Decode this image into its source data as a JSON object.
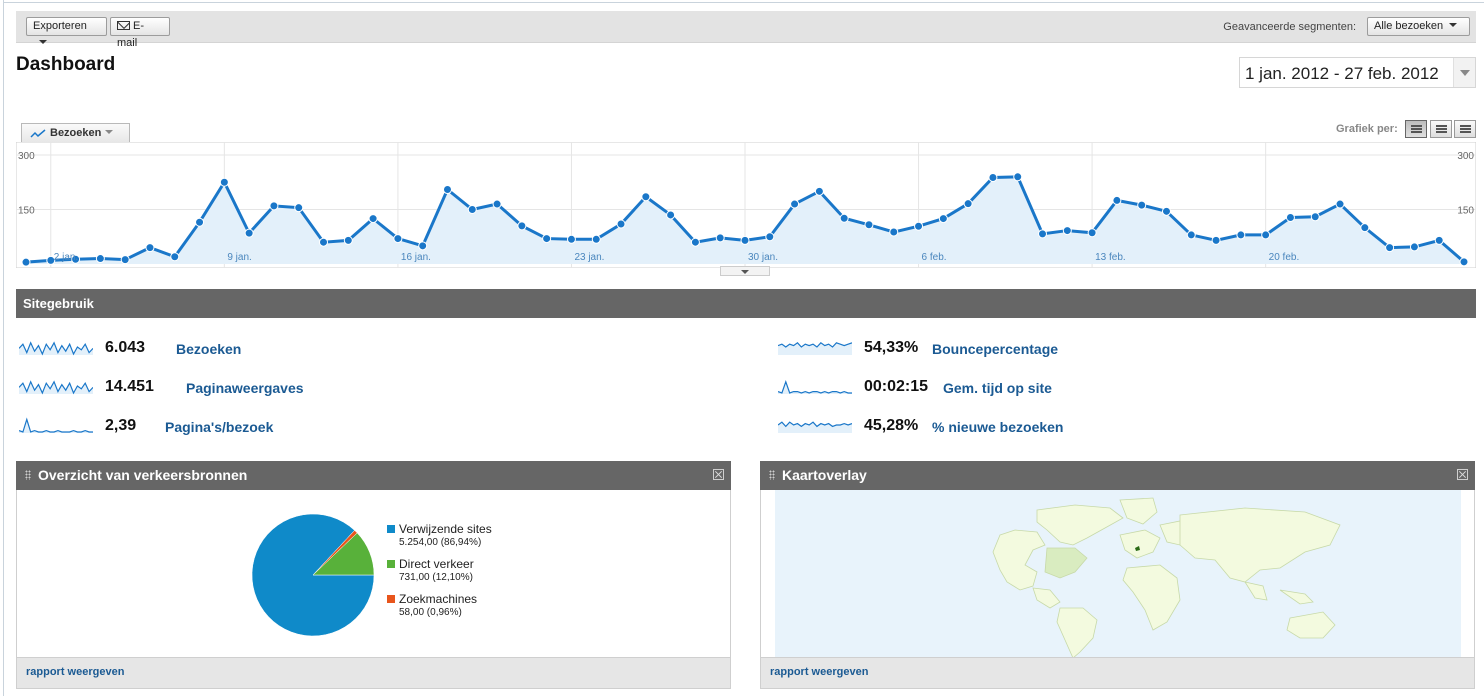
{
  "toolbar": {
    "export_label": "Exporteren",
    "email_label": "E-mail",
    "segments_label": "Geavanceerde segmenten:",
    "segments_value": "Alle bezoeken"
  },
  "page": {
    "title": "Dashboard",
    "date_range": "1 jan. 2012 - 27 feb. 2012"
  },
  "chart_controls": {
    "metric_tab": "Bezoeken",
    "graph_per_label": "Grafiek per:"
  },
  "chart_data": {
    "type": "area",
    "series": [
      {
        "values": [
          5,
          10,
          13,
          15,
          12,
          45,
          20,
          115,
          225,
          85,
          160,
          155,
          60,
          65,
          125,
          70,
          50,
          205,
          150,
          165,
          105,
          70,
          68,
          68,
          110,
          185,
          135,
          60,
          72,
          65,
          75,
          165,
          200,
          126,
          108,
          88,
          104,
          125,
          166,
          238,
          240,
          83,
          92,
          86,
          175,
          162,
          145,
          80,
          65,
          80,
          80,
          128,
          130,
          165,
          100,
          45,
          47,
          65,
          6
        ]
      }
    ],
    "x_tick_labels": [
      "2 jan.",
      "9 jan.",
      "16 jan.",
      "23 jan.",
      "30 jan.",
      "6 feb.",
      "13 feb.",
      "20 feb."
    ],
    "y_tick_labels_left": [
      "300",
      "150"
    ],
    "y_tick_labels_right": [
      "300",
      "150"
    ],
    "ylim": [
      0,
      300
    ],
    "color": "#1a77c9",
    "fill": "#e3f0fa",
    "grid": true
  },
  "site_usage": {
    "title": "Sitegebruik",
    "metrics": [
      {
        "value": "6.043",
        "label": "Bezoeken"
      },
      {
        "value": "14.451",
        "label": "Paginaweergaves"
      },
      {
        "value": "2,39",
        "label": "Pagina's/bezoek"
      },
      {
        "value": "54,33%",
        "label": "Bouncepercentage"
      },
      {
        "value": "00:02:15",
        "label": "Gem. tijd op site"
      },
      {
        "value": "45,28%",
        "label": "% nieuwe bezoeken"
      }
    ]
  },
  "traffic_widget": {
    "title": "Overzicht van verkeersbronnen",
    "footer_link": "rapport weergeven",
    "slices": [
      {
        "name": "Verwijzende sites",
        "value": "5.254,00 (86,94%)",
        "share": 86.94,
        "color": "#0f8ac9"
      },
      {
        "name": "Direct verkeer",
        "value": "731,00 (12,10%)",
        "share": 12.1,
        "color": "#58b13a"
      },
      {
        "name": "Zoekmachines",
        "value": "58,00 (0,96%)",
        "share": 0.96,
        "color": "#e8551c"
      }
    ]
  },
  "map_widget": {
    "title": "Kaartoverlay",
    "footer_link": "rapport weergeven"
  }
}
